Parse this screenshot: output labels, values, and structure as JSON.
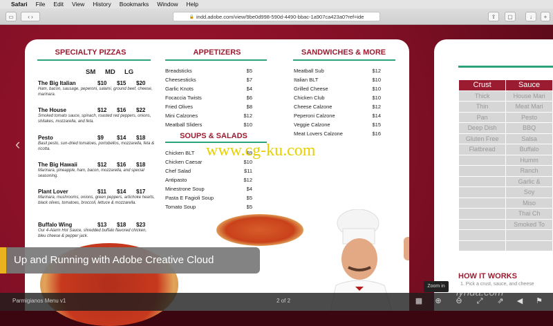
{
  "menubar": {
    "apple": "",
    "app": "Safari",
    "items": [
      "File",
      "Edit",
      "View",
      "History",
      "Bookmarks",
      "Window",
      "Help"
    ]
  },
  "toolbar": {
    "url": "indd.adobe.com/view/9be0d998-590d-4490-bbac-1a907ca423a0?ref=ide"
  },
  "menu": {
    "specialty_title": "SPECIALTY PIZZAS",
    "sizes": [
      "SM",
      "MD",
      "LG"
    ],
    "pizzas": [
      {
        "name": "The Big Italian",
        "prices": [
          "$10",
          "$15",
          "$20"
        ],
        "desc": "Ham, bacon, sausage, peperoni, salami, ground beef, cheese, marinara."
      },
      {
        "name": "The House",
        "prices": [
          "$12",
          "$16",
          "$22"
        ],
        "desc": "Smoked tomato sauce, spinach, roasted red peppers, onions, shitakes, mozzarella, and feta."
      },
      {
        "name": "Pesto",
        "prices": [
          "$9",
          "$14",
          "$18"
        ],
        "desc": "Basil pesto, sun-dried tomatoes, portobellos, mozzarella, feta & ricotta."
      },
      {
        "name": "The Big Hawaii",
        "prices": [
          "$12",
          "$16",
          "$18"
        ],
        "desc": "Marinara, pineapple, ham, bacon, mozzarella, and special seasoning."
      },
      {
        "name": "Plant Lover",
        "prices": [
          "$11",
          "$14",
          "$17"
        ],
        "desc": "Marinara, mushrooms, onions, green peppers, artichoke hearts, black olives, tomatoes, broccoli, lettuce & mozzarella."
      },
      {
        "name": "Buffalo Wing",
        "prices": [
          "$13",
          "$18",
          "$23"
        ],
        "desc": "Our 4-Alarm Hot Sauce, shredded buffalo flavored chicken, bleu cheese & pepper jack."
      }
    ],
    "appetizers_title": "APPETIZERS",
    "appetizers": [
      {
        "name": "Breadsticks",
        "price": "$5"
      },
      {
        "name": "Cheesesticks",
        "price": "$7"
      },
      {
        "name": "Garlic Knots",
        "price": "$4"
      },
      {
        "name": "Focaccia Twists",
        "price": "$6"
      },
      {
        "name": "Fried Olives",
        "price": "$8"
      },
      {
        "name": "Mini Calzones",
        "price": "$12"
      },
      {
        "name": "Meatball Sliders",
        "price": "$10"
      }
    ],
    "soups_title": "SOUPS & SALADS",
    "soups": [
      {
        "name": "Chicken BLT",
        "price": "$9"
      },
      {
        "name": "Chicken Caesar",
        "price": "$10"
      },
      {
        "name": "Chef Salad",
        "price": "$11"
      },
      {
        "name": "Antipasto",
        "price": "$12"
      },
      {
        "name": "Minestrone Soup",
        "price": "$4"
      },
      {
        "name": "Pasta E Fagioli Soup",
        "price": "$5"
      },
      {
        "name": "Tomato Soup",
        "price": "$5"
      }
    ],
    "sandwiches_title": "SANDWICHES & MORE",
    "sandwiches": [
      {
        "name": "Meatball Sub",
        "price": "$12"
      },
      {
        "name": "Italian BLT",
        "price": "$10"
      },
      {
        "name": "Grilled Cheese",
        "price": "$10"
      },
      {
        "name": "Chicken Club",
        "price": "$10"
      },
      {
        "name": "Cheese Calzone",
        "price": "$12"
      },
      {
        "name": "Peperoni Calzone",
        "price": "$14"
      },
      {
        "name": "Veggie Calzone",
        "price": "$15"
      },
      {
        "name": "Meat Lovers Calzone",
        "price": "$16"
      }
    ]
  },
  "page2": {
    "headers": [
      "Crust",
      "Sauce"
    ],
    "rows": [
      [
        "Thick",
        "House Mari"
      ],
      [
        "Thin",
        "Meat Mari"
      ],
      [
        "Pan",
        "Pesto"
      ],
      [
        "Deep Dish",
        "BBQ"
      ],
      [
        "Gluten Free",
        "Salsa"
      ],
      [
        "Flatbread",
        "Buffalo"
      ],
      [
        "",
        "Humm"
      ],
      [
        "",
        "Ranch"
      ],
      [
        "",
        "Garlic &"
      ],
      [
        "",
        "Soy"
      ],
      [
        "",
        "Miso"
      ],
      [
        "",
        "Thai Ch"
      ],
      [
        "",
        "Smoked To"
      ],
      [
        "",
        ""
      ],
      [
        "",
        ""
      ]
    ],
    "how_title": "HOW IT WORKS",
    "how_sub": "1. Pick a crust, sauce, and cheese"
  },
  "watermark": "www.cg-ku.com",
  "lower_third": "Up and Running with Adobe Creative Cloud",
  "bottombar": {
    "doc_name": "Parmigianos Menu v1",
    "page": "2 of 2",
    "zoom_tip": "Zoom in"
  },
  "brand": "lynda.com",
  "colors": {
    "accent_red": "#9b1b30",
    "accent_green": "#2aa37c",
    "lower_third_bar": "#e9b320"
  }
}
